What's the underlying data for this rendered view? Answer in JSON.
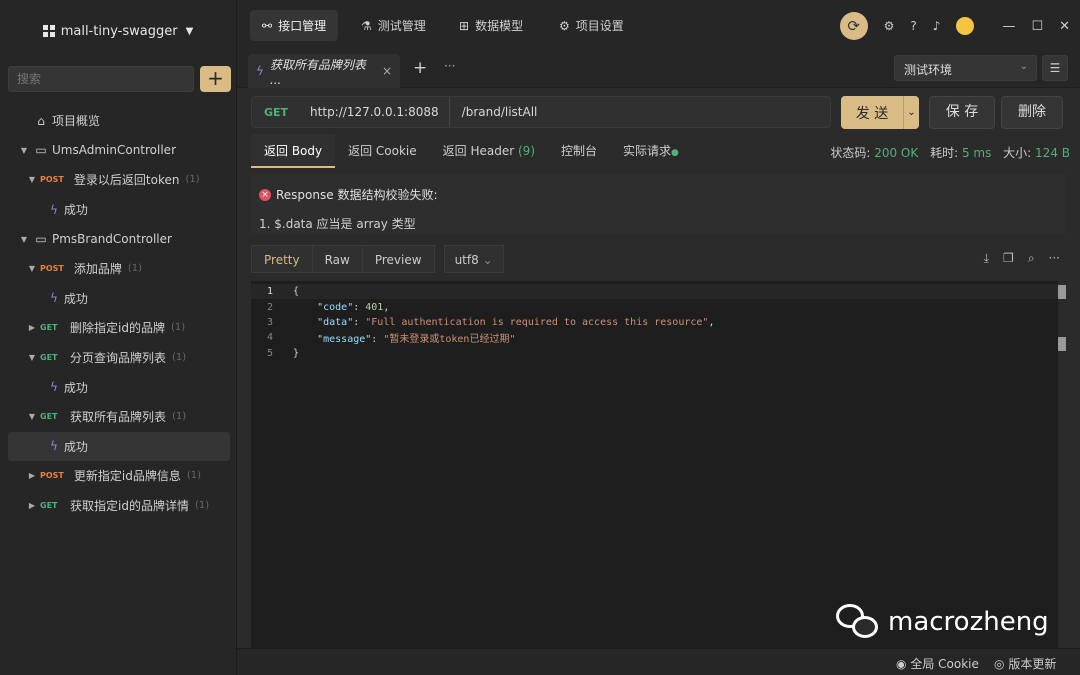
{
  "sidebar": {
    "project_name": "mall-tiny-swagger",
    "search_placeholder": "搜索",
    "add_label": "+",
    "overview_label": "项目概览",
    "tree": [
      {
        "type": "folder",
        "label": "UmsAdminController",
        "indent": 1
      },
      {
        "type": "api",
        "method": "POST",
        "label": "登录以后返回token",
        "count": "(1)",
        "indent": 2
      },
      {
        "type": "case",
        "label": "成功",
        "indent": 3
      },
      {
        "type": "folder",
        "label": "PmsBrandController",
        "indent": 1
      },
      {
        "type": "api",
        "method": "POST",
        "label": "添加品牌",
        "count": "(1)",
        "indent": 2
      },
      {
        "type": "case",
        "label": "成功",
        "indent": 3
      },
      {
        "type": "api-collapsed",
        "method": "GET",
        "label": "删除指定id的品牌",
        "count": "(1)",
        "indent": 2
      },
      {
        "type": "api",
        "method": "GET",
        "label": "分页查询品牌列表",
        "count": "(1)",
        "indent": 2
      },
      {
        "type": "case",
        "label": "成功",
        "indent": 3
      },
      {
        "type": "api",
        "method": "GET",
        "label": "获取所有品牌列表",
        "count": "(1)",
        "indent": 2
      },
      {
        "type": "case-selected",
        "label": "成功",
        "indent": 3
      },
      {
        "type": "api-collapsed",
        "method": "POST",
        "label": "更新指定id品牌信息",
        "count": "(1)",
        "indent": 2
      },
      {
        "type": "api-collapsed",
        "method": "GET",
        "label": "获取指定id的品牌详情",
        "count": "(1)",
        "indent": 2
      }
    ]
  },
  "topbar": {
    "tabs": [
      "接口管理",
      "测试管理",
      "数据模型",
      "项目设置"
    ]
  },
  "tabrow": {
    "request_tab": "获取所有品牌列表 ...",
    "env": "测试环境"
  },
  "request": {
    "method": "GET",
    "host": "http://127.0.0.1:8088",
    "path": "/brand/listAll",
    "send_label": "发 送",
    "save_label": "保 存",
    "delete_label": "删除"
  },
  "response_tabs": {
    "body": "返回 Body",
    "cookie": "返回 Cookie",
    "header": "返回 Header",
    "header_count": "(9)",
    "console": "控制台",
    "actual": "实际请求"
  },
  "status": {
    "code_label": "状态码:",
    "code": "200 OK",
    "time_label": "耗时:",
    "time": "5 ms",
    "size_label": "大小:",
    "size": "124 B"
  },
  "validation": {
    "title": "Response 数据结构校验失败:",
    "message": "1. $.data 应当是 array 类型"
  },
  "view": {
    "modes": [
      "Pretty",
      "Raw",
      "Preview"
    ],
    "encoding": "utf8"
  },
  "body_json": {
    "line1": "{",
    "code_key": "\"code\"",
    "code_val": "401",
    "data_key": "\"data\"",
    "data_val": "\"Full authentication is required to access this resource\"",
    "msg_key": "\"message\"",
    "msg_val": "\"暂未登录或token已经过期\"",
    "line5": "}"
  },
  "watermark": "macrozheng",
  "footer": {
    "cookie": "全局 Cookie",
    "update": "版本更新"
  },
  "colors": {
    "accent": "#d9bb85",
    "get": "#4fb07a",
    "post": "#e87e3a",
    "error": "#e05262"
  }
}
